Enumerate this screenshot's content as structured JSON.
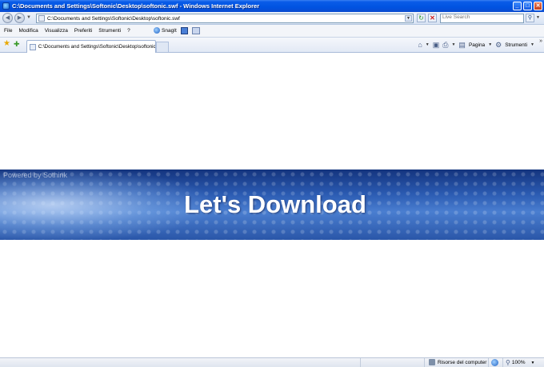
{
  "window": {
    "title": "C:\\Documents and Settings\\Softonic\\Desktop\\softonic.swf - Windows Internet Explorer",
    "minimize": "_",
    "maximize": "□",
    "close": "✕"
  },
  "address_bar": {
    "url": "C:\\Documents and Settings\\Softonic\\Desktop\\softonic.swf",
    "search_placeholder": "Live Search"
  },
  "menu": {
    "items": [
      "File",
      "Modifica",
      "Visualizza",
      "Preferiti",
      "Strumenti",
      "?"
    ],
    "snagit_label": "SnagIt"
  },
  "tabs": [
    {
      "label": "C:\\Documents and Settings\\Softonic\\Desktop\\softonic..."
    }
  ],
  "command_bar": {
    "page_label": "Pagina",
    "tools_label": "Strumenti"
  },
  "content": {
    "powered_by": "Powered by Sothink",
    "headline": "Let's Download"
  },
  "status_bar": {
    "zone_label": "Risorse del computer",
    "zoom": "100%"
  },
  "icons": {
    "back": "back-arrow-icon",
    "forward": "forward-arrow-icon",
    "refresh": "refresh-icon",
    "stop": "stop-icon",
    "search": "search-icon",
    "favorites": "favorites-star-icon",
    "add_favorite": "add-favorite-icon",
    "home": "home-icon",
    "feeds": "feeds-icon",
    "print": "print-icon",
    "zoom": "zoom-icon"
  },
  "colors": {
    "titlebar": "#0053e1",
    "banner_dark": "#14347e",
    "banner_light": "#4a7ed0"
  }
}
